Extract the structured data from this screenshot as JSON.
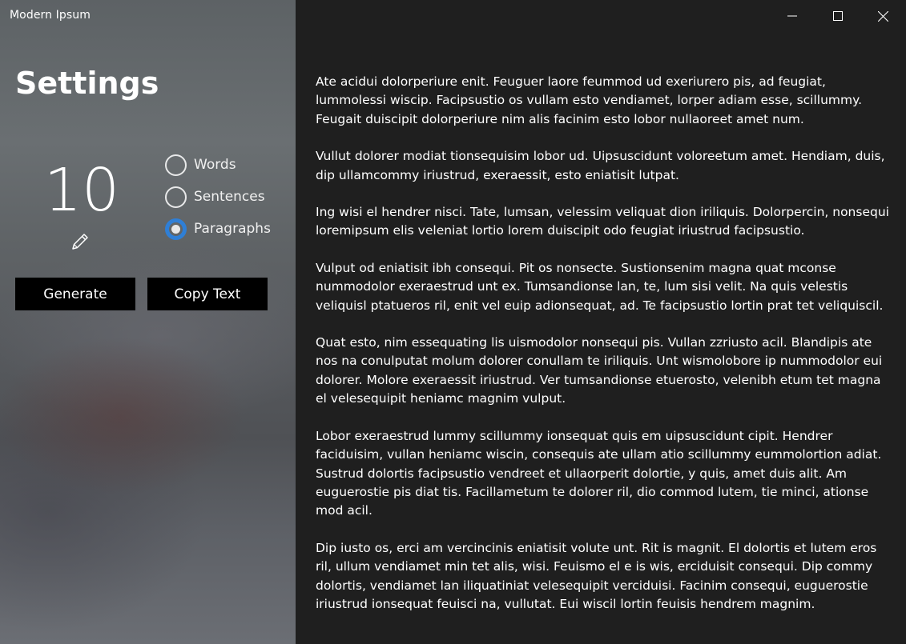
{
  "window": {
    "app_title": "Modern Ipsum",
    "caption": {
      "minimize_icon": "minimize-icon",
      "maximize_icon": "maximize-icon",
      "close_icon": "close-icon"
    }
  },
  "settings": {
    "title": "Settings",
    "count": "10",
    "edit_icon": "pencil-icon",
    "options": [
      {
        "label": "Words",
        "checked": false
      },
      {
        "label": "Sentences",
        "checked": false
      },
      {
        "label": "Paragraphs",
        "checked": true
      }
    ],
    "generate_label": "Generate",
    "copy_label": "Copy Text"
  },
  "content": {
    "paragraphs": [
      "Ate acidui dolorperiure enit. Feuguer laore feummod ud exeriurero pis, ad feugiat, lummolessi wiscip. Facipsustio os vullam esto vendiamet, lorper adiam esse, scillummy. Feugait duiscipit dolorperiure nim alis facinim esto lobor nullaoreet amet num.",
      "Vullut dolorer modiat tionsequisim lobor ud. Uipsuscidunt voloreetum amet. Hendiam, duis, dip ullamcommy iriustrud, exeraessit, esto eniatisit lutpat.",
      "Ing wisi el hendrer nisci. Tate, lumsan, velessim veliquat dion iriliquis. Dolorpercin, nonsequi loremipsum elis veleniat lortio lorem duiscipit odo feugiat iriustrud facipsustio.",
      "Vulput od eniatisit ibh consequi. Pit os nonsecte. Sustionsenim magna quat mconse nummodolor exeraestrud unt ex. Tumsandionse lan, te, lum sisi velit. Na quis velestis veliquisl ptatueros ril, enit vel euip adionsequat, ad. Te facipsustio lortin prat tet veliquiscil.",
      "Quat esto, nim essequating lis uismodolor nonsequi pis. Vullan zzriusto acil. Blandipis ate nos na conulputat molum dolorer conullam te iriliquis. Unt wismolobore ip nummodolor eui dolorer. Molore exeraessit iriustrud. Ver tumsandionse etuerosto, velenibh etum tet magna el velesequipit heniamc magnim vulput.",
      "Lobor exeraestrud lummy scillummy ionsequat quis em uipsuscidunt cipit. Hendrer faciduisim, vullan heniamc wiscin, consequis ate ullam atio scillummy eummolortion adiat. Sustrud dolortis facipsustio vendreet et ullaorperit dolortie, y quis, amet duis alit. Am euguerostie pis diat tis. Facillametum te dolorer ril, dio commod lutem, tie minci, ationse mod acil.",
      "Dip iusto os, erci am vercincinis eniatisit volute unt. Rit is magnit. El dolortis et lutem eros ril, ullum vendiamet min tet alis, wisi. Feuismo el e is wis, erciduisit consequi. Dip commy dolortis, vendiamet lan iliquatiniat velesequipit verciduisi. Facinim consequi, euguerostie iriustrud ionsequat feuisci na, vullutat. Eui wiscil lortin feuisis hendrem magnim."
    ]
  }
}
